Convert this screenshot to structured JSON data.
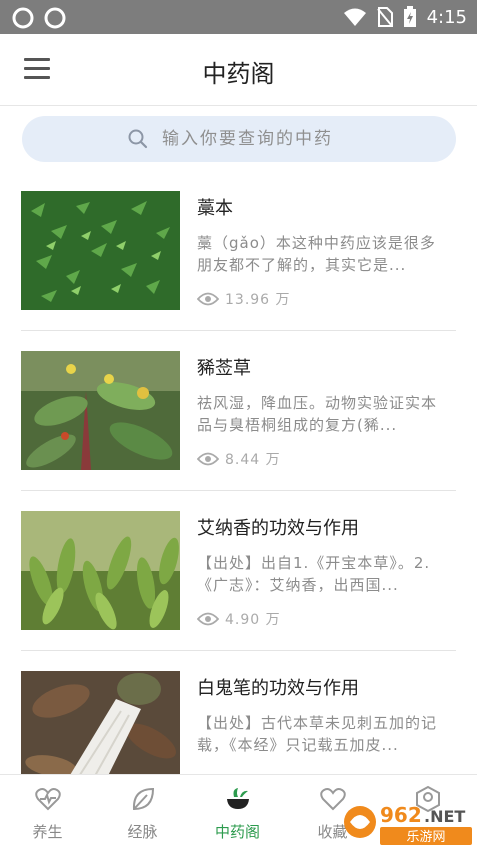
{
  "status_bar": {
    "time": "4:15",
    "icons": [
      "vpn-icon",
      "vpn-icon",
      "wifi-icon",
      "no-sim-icon",
      "battery-charging-icon"
    ]
  },
  "app_bar": {
    "title": "中药阁",
    "menu_icon": "hamburger-menu-icon"
  },
  "search": {
    "placeholder": "输入你要查询的中药",
    "icon": "search-icon"
  },
  "items": [
    {
      "name": "藁本",
      "desc": "藁（gǎo）本这种中药应该是很多朋友都不了解的，其实它是...",
      "views": "13.96 万"
    },
    {
      "name": "豨莶草",
      "desc": "祛风湿，降血压。动物实验证实本品与臭梧桐组成的复方(豨...",
      "views": "8.44 万"
    },
    {
      "name": "艾纳香的功效与作用",
      "desc": "【出处】出自1.《开宝本草》。2.《广志》：艾纳香，出西国...",
      "views": "4.90 万"
    },
    {
      "name": "白鬼笔的功效与作用",
      "desc": "【出处】古代本草未见刺五加的记载，《本经》只记载五加皮...",
      "views": ""
    }
  ],
  "tabs": [
    {
      "label": "养生",
      "icon": "heart-pulse-icon",
      "active": false
    },
    {
      "label": "经脉",
      "icon": "leaf-icon",
      "active": false
    },
    {
      "label": "中药阁",
      "icon": "herb-bowl-icon",
      "active": true
    },
    {
      "label": "收藏",
      "icon": "heart-icon",
      "active": false
    },
    {
      "label": "",
      "icon": "profile-icon",
      "active": false
    }
  ],
  "watermark": {
    "text": "962.NET",
    "subtext": "乐游网"
  },
  "colors": {
    "accent": "#2d9b4e",
    "search_bg": "#e5edf8",
    "status_bar": "#7d7d7d"
  }
}
